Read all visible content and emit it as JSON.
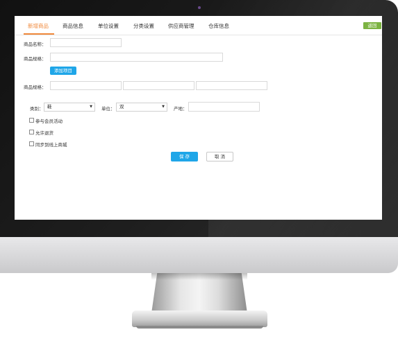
{
  "tabs": [
    {
      "label": "新增商品",
      "active": true
    },
    {
      "label": "商品信息",
      "active": false
    },
    {
      "label": "单位设置",
      "active": false
    },
    {
      "label": "分类设置",
      "active": false
    },
    {
      "label": "供应商管理",
      "active": false
    },
    {
      "label": "仓库信息",
      "active": false
    }
  ],
  "back_button": "返回",
  "form": {
    "product_name_label": "商品名称：",
    "product_name_value": "",
    "product_spec_label": "商品规格：",
    "product_spec_value": "",
    "add_item_button": "添加项目",
    "product_spec2_label": "商品规格：",
    "spec_values": [
      "",
      "",
      ""
    ],
    "category_label": "类别：",
    "category_value": "鞋",
    "unit_label": "单位：",
    "unit_value": "双",
    "origin_label": "产地：",
    "origin_value": "",
    "checkboxes": [
      {
        "label": "参与会员活动",
        "checked": false
      },
      {
        "label": "允许退货",
        "checked": false
      },
      {
        "label": "同步到线上商城",
        "checked": false
      }
    ],
    "save_button": "保 存",
    "cancel_button": "取 消"
  },
  "colors": {
    "accent": "#f0883a",
    "primary_button": "#1fa6e8",
    "back_button": "#7cb342"
  }
}
